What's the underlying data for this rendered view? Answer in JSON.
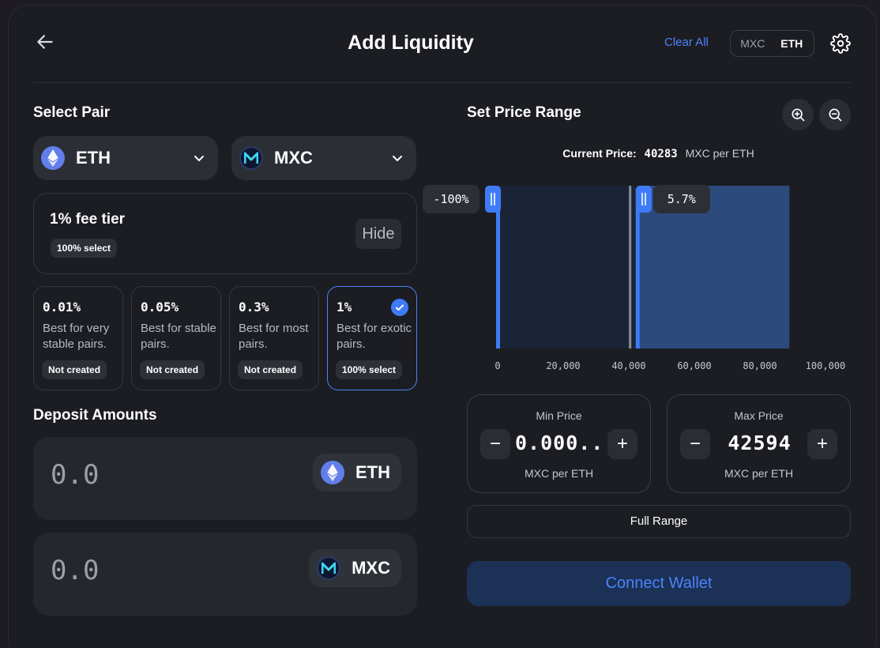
{
  "header": {
    "title": "Add Liquidity",
    "clear_all": "Clear All",
    "toggle": [
      "MXC",
      "ETH"
    ]
  },
  "select_pair": {
    "title": "Select Pair",
    "token_a": {
      "symbol": "ETH",
      "icon": "eth-icon"
    },
    "token_b": {
      "symbol": "MXC",
      "icon": "mxc-icon"
    }
  },
  "fee": {
    "title": "1% fee tier",
    "badge": "100% select",
    "hide_label": "Hide",
    "tiers": [
      {
        "pct": "0.01%",
        "desc": "Best for very stable pairs.",
        "status": "Not created",
        "selected": false
      },
      {
        "pct": "0.05%",
        "desc": "Best for stable pairs.",
        "status": "Not created",
        "selected": false
      },
      {
        "pct": "0.3%",
        "desc": "Best for most pairs.",
        "status": "Not created",
        "selected": false
      },
      {
        "pct": "1%",
        "desc": "Best for exotic pairs.",
        "status": "100% select",
        "selected": true
      }
    ]
  },
  "deposit": {
    "title": "Deposit Amounts",
    "token_a": {
      "amount": "0.0",
      "symbol": "ETH"
    },
    "token_b": {
      "amount": "0.0",
      "symbol": "MXC"
    }
  },
  "range": {
    "title": "Set Price Range",
    "current_price_label": "Current Price:",
    "current_price": "40283",
    "current_price_unit": "MXC per ETH",
    "min_pct": "-100%",
    "max_pct": "5.7%",
    "min": {
      "label": "Min Price",
      "value": "0.000...",
      "unit": "MXC per ETH"
    },
    "max": {
      "label": "Max Price",
      "value": "42594",
      "unit": "MXC per ETH"
    },
    "full_range": "Full Range",
    "connect": "Connect Wallet"
  },
  "chart_data": {
    "type": "area",
    "x_ticks": [
      "0",
      "20,000",
      "40,000",
      "60,000",
      "80,000",
      "100,000"
    ],
    "xlim": [
      0,
      100000
    ],
    "liquidity_extent": [
      0,
      89000
    ],
    "current_price": 40283,
    "range_min": 0,
    "range_max": 42594,
    "colors": {
      "range_left": "#1b2337",
      "range_right": "#2d4a7d",
      "handle": "#3f7bf6",
      "current": "#8a8f99"
    }
  },
  "colors": {
    "accent": "#4c82fb",
    "card": "#1b1d22"
  }
}
